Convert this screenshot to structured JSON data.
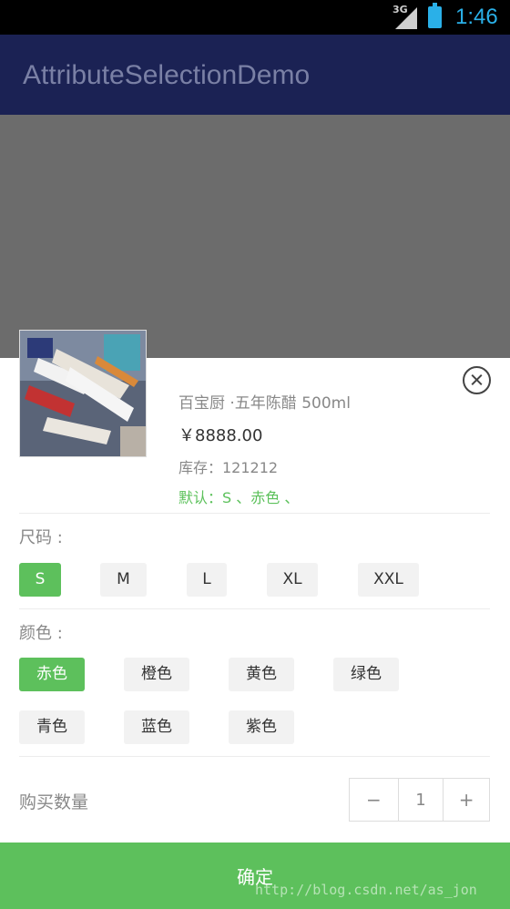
{
  "status_bar": {
    "network": "3G",
    "time": "1:46"
  },
  "app_bar": {
    "title": "AttributeSelectionDemo"
  },
  "product": {
    "name": "百宝厨 ·五年陈醋 500ml",
    "price": "￥8888.00",
    "stock": "库存：121212",
    "default_selection": "默认：S 、赤色 、"
  },
  "size_section": {
    "label": "尺码 :",
    "options": [
      "S",
      "M",
      "L",
      "XL",
      "XXL"
    ],
    "selected": "S"
  },
  "color_section": {
    "label": "颜色 :",
    "options": [
      "赤色",
      "橙色",
      "黄色",
      "绿色",
      "青色",
      "蓝色",
      "紫色"
    ],
    "selected": "赤色"
  },
  "quantity": {
    "label": "购买数量",
    "minus": "−",
    "value": "1",
    "plus": "+"
  },
  "confirm_button": {
    "label": "确定"
  },
  "watermark": "http://blog.csdn.net/as_jon",
  "colors": {
    "accent": "#5dc05c",
    "app_bar": "#1b2254",
    "overlay": "#6c6c6c"
  }
}
